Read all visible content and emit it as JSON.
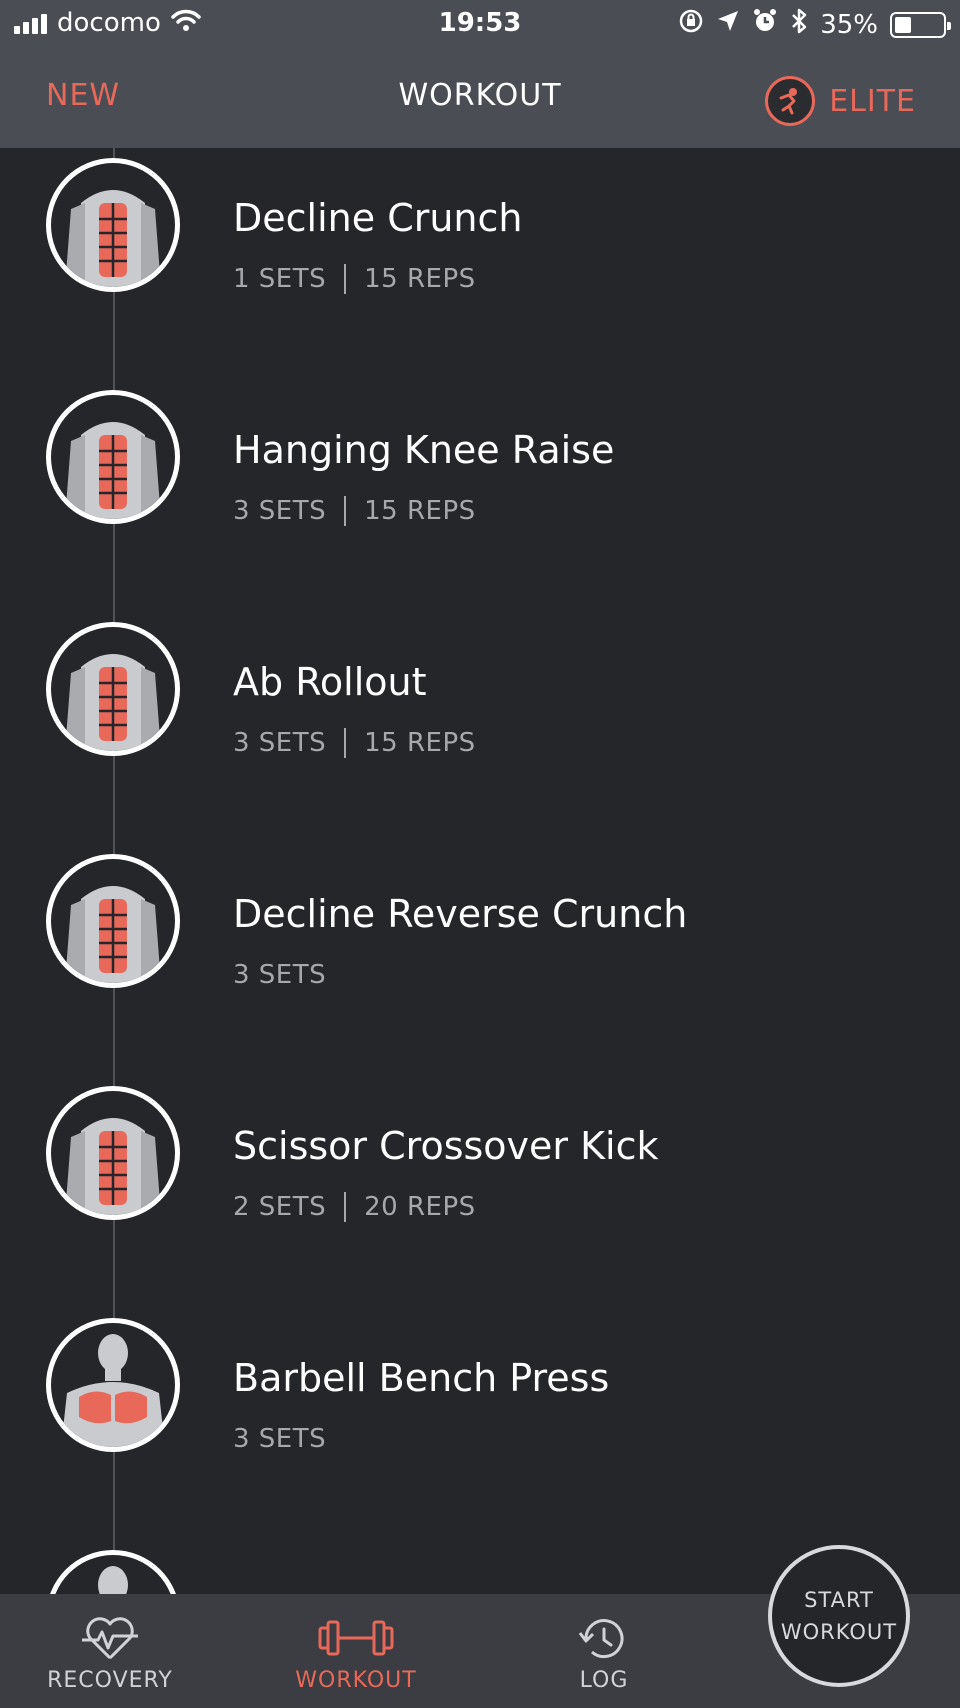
{
  "status_bar": {
    "carrier": "docomo",
    "time": "19:53",
    "battery": "35%",
    "battery_level": 0.35
  },
  "nav": {
    "left": "NEW",
    "title": "WORKOUT",
    "right": "ELITE"
  },
  "exercises": [
    {
      "name": "Decline Crunch",
      "sets": "1 SETS",
      "reps": "15 REPS",
      "muscle": "abs"
    },
    {
      "name": "Hanging Knee Raise",
      "sets": "3 SETS",
      "reps": "15 REPS",
      "muscle": "abs"
    },
    {
      "name": "Ab Rollout",
      "sets": "3 SETS",
      "reps": "15 REPS",
      "muscle": "abs"
    },
    {
      "name": "Decline Reverse Crunch",
      "sets": "3 SETS",
      "reps": "",
      "muscle": "abs"
    },
    {
      "name": "Scissor Crossover Kick",
      "sets": "2 SETS",
      "reps": "20 REPS",
      "muscle": "abs"
    },
    {
      "name": "Barbell Bench Press",
      "sets": "3 SETS",
      "reps": "",
      "muscle": "chest"
    }
  ],
  "tabs": [
    {
      "label": "RECOVERY",
      "icon": "heart-pulse-icon"
    },
    {
      "label": "WORKOUT",
      "icon": "dumbbell-icon",
      "active": true
    },
    {
      "label": "LOG",
      "icon": "clock-history-icon"
    }
  ],
  "start_button": {
    "line1": "START",
    "line2": "WORKOUT"
  },
  "colors": {
    "accent": "#e8695a",
    "background": "#25262a",
    "header": "#4a4d53",
    "tabbar": "#3b3d42",
    "muted_text": "#a6a8ad"
  }
}
